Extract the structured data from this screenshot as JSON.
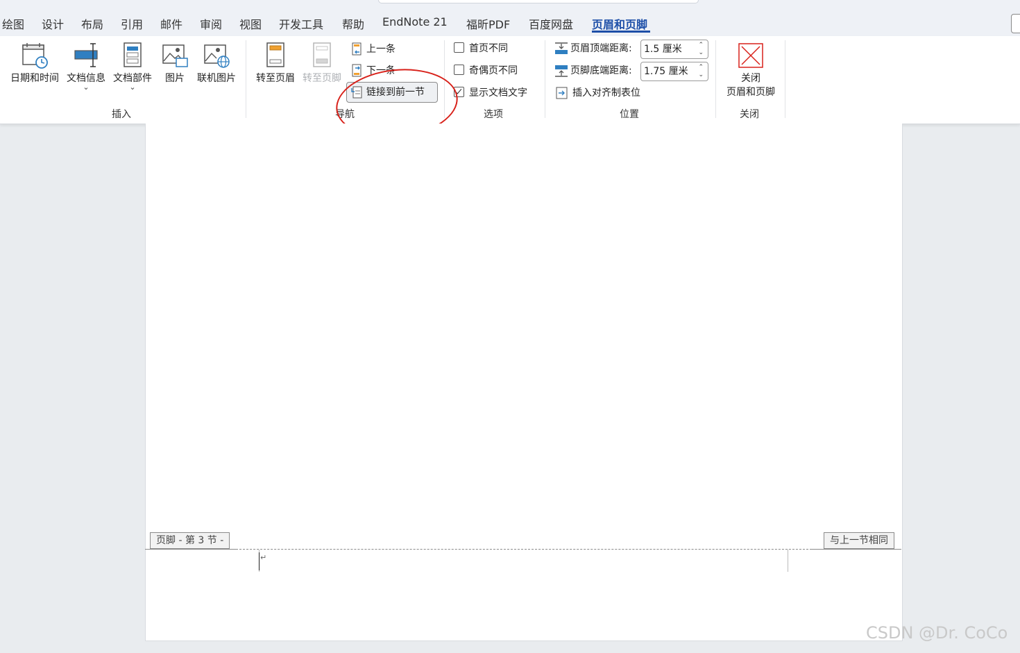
{
  "tabs": [
    "绘图",
    "设计",
    "布局",
    "引用",
    "邮件",
    "审阅",
    "视图",
    "开发工具",
    "帮助",
    "EndNote 21",
    "福昕PDF",
    "百度网盘",
    "页眉和页脚"
  ],
  "active_tab": "页眉和页脚",
  "ribbon": {
    "insert_group": {
      "label": "插入",
      "date_time": "日期和时间",
      "doc_info": "文档信息",
      "doc_parts": "文档部件",
      "picture": "图片",
      "online_picture": "联机图片"
    },
    "nav_group": {
      "label": "导航",
      "goto_header": "转至页眉",
      "goto_footer": "转至页脚",
      "previous": "上一条",
      "next": "下一条",
      "link_to_previous": "链接到前一节"
    },
    "options_group": {
      "label": "选项",
      "different_first_page": "首页不同",
      "different_odd_even": "奇偶页不同",
      "show_doc_text": "显示文档文字",
      "different_first_page_checked": false,
      "different_odd_even_checked": false,
      "show_doc_text_checked": true
    },
    "position_group": {
      "label": "位置",
      "header_from_top": "页眉顶端距离:",
      "header_from_top_value": "1.5 厘米",
      "footer_from_bottom": "页脚底端距离:",
      "footer_from_bottom_value": "1.75 厘米",
      "insert_align_tab": "插入对齐制表位"
    },
    "close_group": {
      "label": "关闭",
      "close_line1": "关闭",
      "close_line2": "页眉和页脚"
    }
  },
  "document": {
    "footer_tag": "页脚 - 第 3 节 -",
    "same_as_previous": "与上一节相同"
  },
  "watermark": "CSDN @Dr. CoCo",
  "colors": {
    "accent": "#1d4fa8",
    "annotation": "#d8211a",
    "close_icon": "#d8211a"
  }
}
